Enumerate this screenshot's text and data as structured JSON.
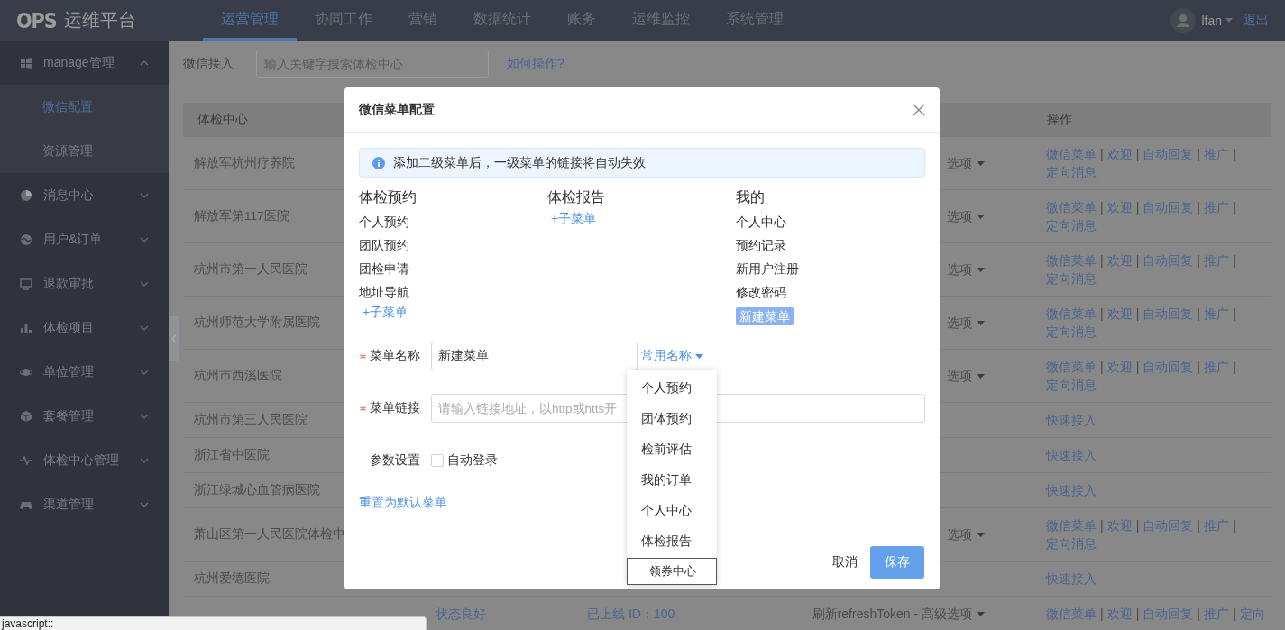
{
  "header": {
    "logo_mark": "OPS",
    "logo_text": "运维平台",
    "nav": [
      {
        "label": "运营管理",
        "selected": true
      },
      {
        "label": "协同工作",
        "selected": false
      },
      {
        "label": "营销",
        "selected": false
      },
      {
        "label": "数据统计",
        "selected": false
      },
      {
        "label": "账务",
        "selected": false
      },
      {
        "label": "运维监控",
        "selected": false
      },
      {
        "label": "系统管理",
        "selected": false
      }
    ],
    "user": "lfan",
    "logout": "退出"
  },
  "sidebar": {
    "groups": [
      {
        "label": "manage管理",
        "expanded": true,
        "children": [
          {
            "label": "微信配置",
            "selected": true
          },
          {
            "label": "资源管理",
            "selected": false
          }
        ]
      },
      {
        "label": "消息中心",
        "expanded": false
      },
      {
        "label": "用户&订单",
        "expanded": false
      },
      {
        "label": "退款审批",
        "expanded": false
      },
      {
        "label": "体检项目",
        "expanded": false
      },
      {
        "label": "单位管理",
        "expanded": false
      },
      {
        "label": "套餐管理",
        "expanded": false
      },
      {
        "label": "体检中心管理",
        "expanded": false
      },
      {
        "label": "渠道管理",
        "expanded": false
      }
    ]
  },
  "toolbar": {
    "label": "微信接入",
    "search": {
      "placeholder": "输入关键字搜索体检中心"
    },
    "help_link": "如何操作?"
  },
  "table": {
    "columns": {
      "first": "体检中心",
      "actions": "操作"
    },
    "separator": "|",
    "rows": [
      {
        "name": "解放军杭州疗养院",
        "options": "选项",
        "actions": [
          "微信菜单",
          "欢迎",
          "自动回复",
          "推广",
          "定向消息"
        ]
      },
      {
        "name": "解放军第117医院",
        "options": "选项",
        "actions": [
          "微信菜单",
          "欢迎",
          "自动回复",
          "推广",
          "定向消息"
        ]
      },
      {
        "name": "杭州市第一人民医院",
        "options": "选项",
        "actions": [
          "微信菜单",
          "欢迎",
          "自动回复",
          "推广",
          "定向消息"
        ]
      },
      {
        "name": "杭州师范大学附属医院",
        "options": "选项",
        "actions": [
          "微信菜单",
          "欢迎",
          "自动回复",
          "推广",
          "定向消息"
        ]
      },
      {
        "name": "杭州市西溪医院",
        "options": "选项",
        "actions": [
          "微信菜单",
          "欢迎",
          "自动回复",
          "推广",
          "定向消息"
        ]
      },
      {
        "name": "杭州市第三人民医院",
        "actions": [
          "快速接入"
        ]
      },
      {
        "name": "浙江省中医院",
        "actions": [
          "快速接入"
        ]
      },
      {
        "name": "浙江绿城心血管病医院",
        "actions": [
          "快速接入"
        ]
      },
      {
        "name": "萧山区第一人民医院体检中",
        "options": "选项",
        "actions": [
          "微信菜单",
          "欢迎",
          "自动回复",
          "推广",
          "定向消息"
        ]
      },
      {
        "name": "杭州爱德医院",
        "actions": [
          "快速接入"
        ]
      },
      {
        "status": "状态良好",
        "online": "已上线 ID：100",
        "options": "刷新refreshToken - 高级选项",
        "actions": [
          "微信菜单",
          "欢迎",
          "自动回复",
          "推广",
          "定向"
        ]
      }
    ]
  },
  "modal": {
    "title": "微信菜单配置",
    "alert": "添加二级菜单后，一级菜单的链接将自动失效",
    "menus": [
      {
        "title": "体检预约",
        "items": [
          {
            "label": "个人预约",
            "selected": false
          },
          {
            "label": "团队预约",
            "selected": false
          },
          {
            "label": "团检申请",
            "selected": false
          },
          {
            "label": "地址导航",
            "selected": false
          }
        ],
        "add_link": "+子菜单"
      },
      {
        "title": "体检报告",
        "add_link": "+子菜单"
      },
      {
        "title": "我的",
        "items": [
          {
            "label": "个人中心",
            "selected": false
          },
          {
            "label": "预约记录",
            "selected": false
          },
          {
            "label": "新用户注册",
            "selected": false
          },
          {
            "label": "修改密码",
            "selected": false
          },
          {
            "label": "新建菜单",
            "selected": true
          }
        ]
      }
    ],
    "name_field": {
      "label": "菜单名称",
      "required": true,
      "value": "新建菜单",
      "preset_link": "常用名称",
      "presets": [
        {
          "label": "个人预约",
          "selected": false
        },
        {
          "label": "团体预约",
          "selected": false
        },
        {
          "label": "检前评估",
          "selected": false
        },
        {
          "label": "我的订单",
          "selected": false
        },
        {
          "label": "个人中心",
          "selected": false
        },
        {
          "label": "体检报告",
          "selected": false
        },
        {
          "label": "领券中心",
          "selected": true
        }
      ]
    },
    "link_field": {
      "label": "菜单链接",
      "required": true,
      "placeholder": "请输入链接地址，以http或htts开"
    },
    "params": {
      "label": "参数设置",
      "options": [
        {
          "label": "自动登录",
          "checked": false
        }
      ]
    },
    "reset_link": "重置为默认菜单",
    "buttons": [
      {
        "label": "取消",
        "kind": "default"
      },
      {
        "label": "保存",
        "kind": "primary"
      }
    ]
  },
  "status_bar": {
    "text": "javascript::"
  }
}
